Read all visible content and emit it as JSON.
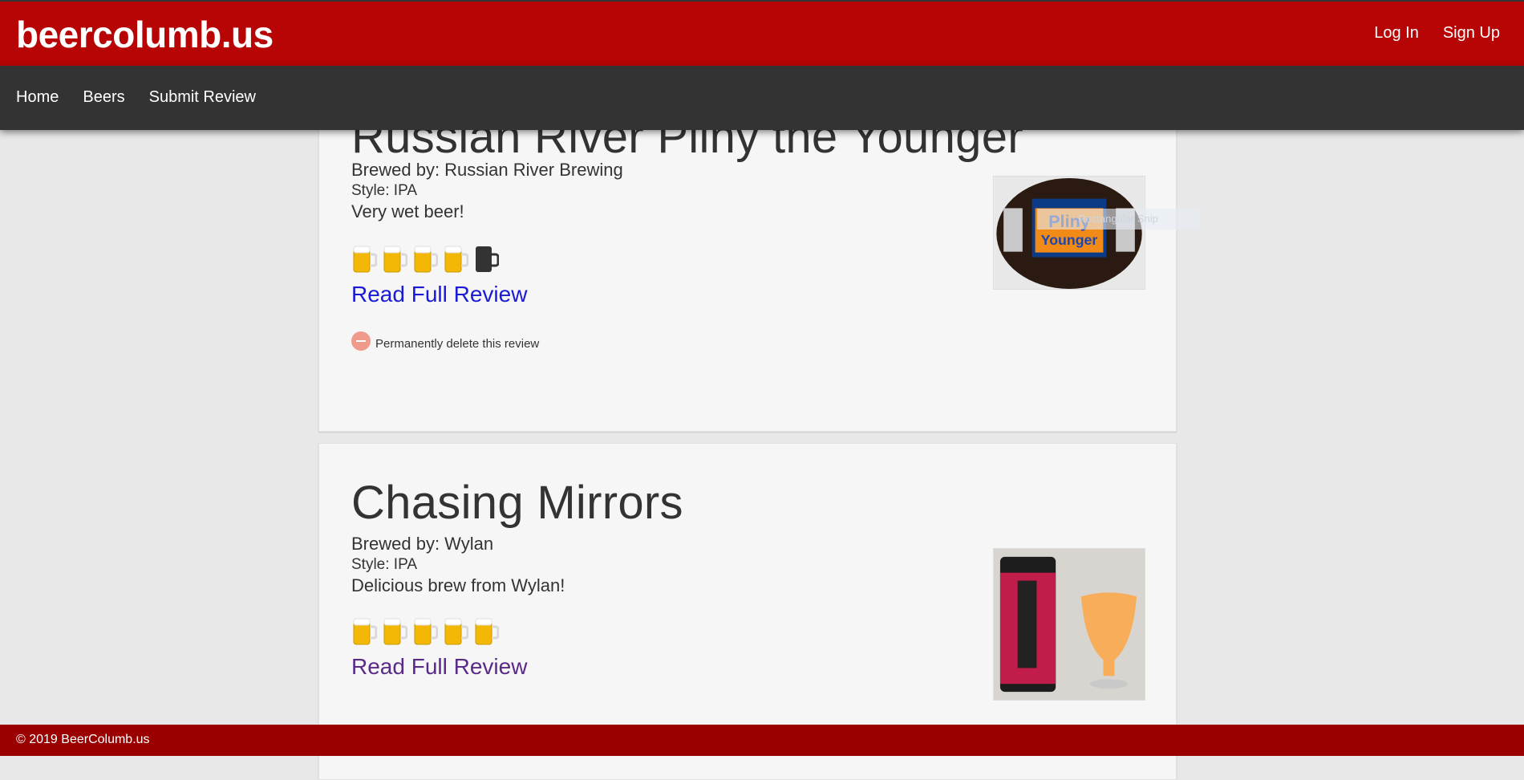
{
  "header": {
    "brand": "beercolumb.us",
    "login": "Log In",
    "signup": "Sign Up"
  },
  "nav": {
    "items": [
      "Home",
      "Beers",
      "Submit Review"
    ]
  },
  "overlay": {
    "snip_label": "Rectangular Snip"
  },
  "reviews": [
    {
      "title": "Russian River Pliny the Younger",
      "brewer": "Brewed by: Russian River Brewing",
      "style": "Style: IPA",
      "description": "Very wet beer!",
      "rating": 4,
      "rating_max": 5,
      "read_more": "Read Full Review",
      "delete_text": "Permanently delete this review",
      "image_alt": "Pliny the Younger bottle"
    },
    {
      "title": "Chasing Mirrors",
      "brewer": "Brewed by: Wylan",
      "style": "Style: IPA",
      "description": "Delicious brew from Wylan!",
      "rating": 5,
      "rating_max": 5,
      "read_more": "Read Full Review",
      "image_alt": "Chasing Mirrors can and glass"
    }
  ],
  "footer": {
    "copyright": "© 2019 BeerColumb.us"
  }
}
